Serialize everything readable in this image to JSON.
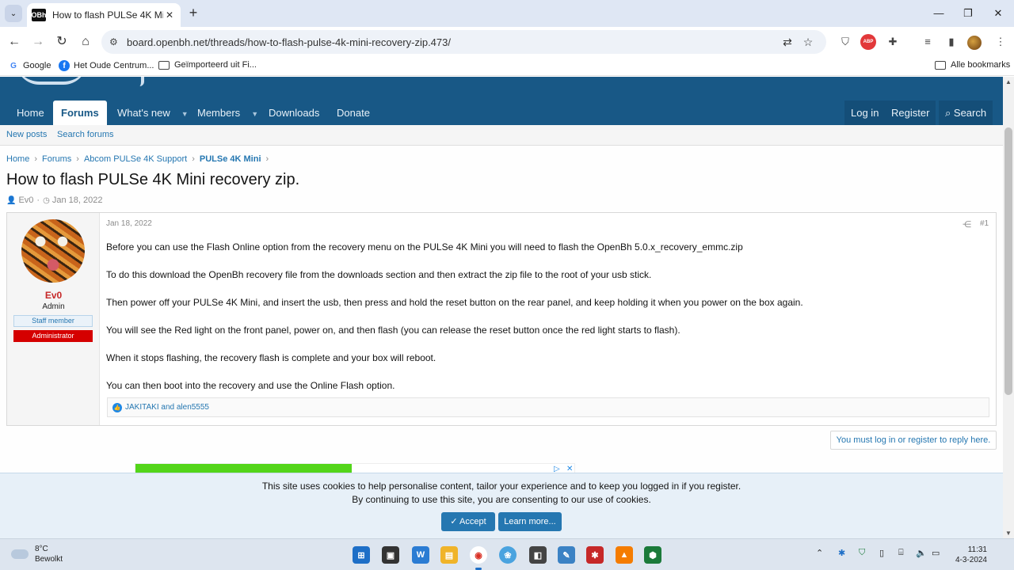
{
  "browser": {
    "tab_title": "How to flash PULSe 4K Mini recovery zip.",
    "favicon_text": "OBh",
    "url": "board.openbh.net/threads/how-to-flash-pulse-4k-mini-recovery-zip.473/",
    "bookmarks": [
      {
        "label": "Google",
        "icon": "google-icon"
      },
      {
        "label": "Het Oude Centrum...",
        "icon": "facebook-icon"
      },
      {
        "label": "Geïmporteerd uit Fi...",
        "icon": "folder-icon"
      }
    ],
    "all_bookmarks_label": "Alle bookmarks",
    "window_controls": {
      "minimize": "—",
      "maximize": "❐",
      "close": "✕"
    }
  },
  "site": {
    "nav": {
      "home": "Home",
      "forums": "Forums",
      "whats_new": "What's new",
      "members": "Members",
      "downloads": "Downloads",
      "donate": "Donate",
      "login": "Log in",
      "register": "Register",
      "search": "Search"
    },
    "subnav": {
      "new_posts": "New posts",
      "search_forums": "Search forums"
    },
    "breadcrumbs": [
      "Home",
      "Forums",
      "Abcom PULSe 4K Support",
      "PULSe 4K Mini"
    ],
    "thread_title": "How to flash PULSe 4K Mini recovery zip.",
    "thread_author": "Ev0",
    "thread_date": "Jan 18, 2022"
  },
  "post": {
    "user": {
      "name": "Ev0",
      "title": "Admin",
      "badge1": "Staff member",
      "badge2": "Administrator"
    },
    "date": "Jan 18, 2022",
    "number": "#1",
    "paragraphs": [
      "Before you can use the Flash Online option from the recovery menu on the PULSe 4K Mini you will need to flash the OpenBh 5.0.x_recovery_emmc.zip",
      "To do this download the OpenBh recovery file from the downloads section and then extract the zip file to the root of your usb stick.",
      "Then power off your PULSe 4K Mini, and insert the usb, then press and hold the reset button on the rear panel, and keep holding it when you power on the box again.",
      "You will see the Red light on the front panel, power on, and then flash (you can release the reset button once the red light starts to flash).",
      "When it stops flashing, the recovery flash is complete and your box will reboot.",
      "You can then boot into the recovery and use the Online Flash option."
    ],
    "reactions": "JAKITAKI and alen5555"
  },
  "reply_note": "You must log in or register to reply here.",
  "cookie": {
    "line1": "This site uses cookies to help personalise content, tailor your experience and to keep you logged in if you register.",
    "line2": "By continuing to use this site, you are consenting to our use of cookies.",
    "accept": "Accept",
    "learn_more": "Learn more..."
  },
  "taskbar": {
    "temp": "8°C",
    "weather": "Bewolkt",
    "time": "11:31",
    "date": "4-3-2024"
  },
  "colors": {
    "header": "#185886",
    "link": "#2577b1",
    "username": "#c62828",
    "admin_badge": "#d50000"
  }
}
